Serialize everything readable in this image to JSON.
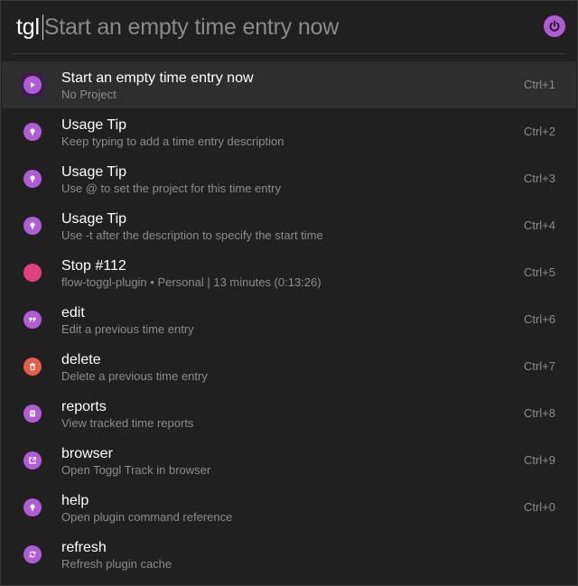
{
  "query": {
    "text": "tgl",
    "suggestion": "Start an empty time entry now"
  },
  "colors": {
    "accent": "#b25bd6",
    "stop": "#e1417c",
    "delete": "#e35f4e",
    "background": "#202020",
    "selected": "#2e2e2e"
  },
  "results": [
    {
      "title": "Start an empty time entry now",
      "subtitle": "No Project",
      "hotkey": "Ctrl+1",
      "icon": "play-icon"
    },
    {
      "title": "Usage Tip",
      "subtitle": "Keep typing to add a time entry description",
      "hotkey": "Ctrl+2",
      "icon": "tip-icon"
    },
    {
      "title": "Usage Tip",
      "subtitle": "Use @ to set the project for this time entry",
      "hotkey": "Ctrl+3",
      "icon": "tip-icon"
    },
    {
      "title": "Usage Tip",
      "subtitle": "Use -t after the description to specify the start time",
      "hotkey": "Ctrl+4",
      "icon": "tip-icon"
    },
    {
      "title": "Stop #112",
      "subtitle": "flow-toggl-plugin • Personal | 13 minutes (0:13:26)",
      "hotkey": "Ctrl+5",
      "icon": "stop-dot-icon"
    },
    {
      "title": "edit",
      "subtitle": "Edit a previous time entry",
      "hotkey": "Ctrl+6",
      "icon": "quote-icon"
    },
    {
      "title": "delete",
      "subtitle": "Delete a previous time entry",
      "hotkey": "Ctrl+7",
      "icon": "trash-icon"
    },
    {
      "title": "reports",
      "subtitle": "View tracked time reports",
      "hotkey": "Ctrl+8",
      "icon": "report-icon"
    },
    {
      "title": "browser",
      "subtitle": "Open Toggl Track in browser",
      "hotkey": "Ctrl+9",
      "icon": "external-link-icon"
    },
    {
      "title": "help",
      "subtitle": "Open plugin command reference",
      "hotkey": "Ctrl+0",
      "icon": "tip-icon"
    },
    {
      "title": "refresh",
      "subtitle": "Refresh plugin cache",
      "hotkey": "",
      "icon": "refresh-icon"
    }
  ]
}
